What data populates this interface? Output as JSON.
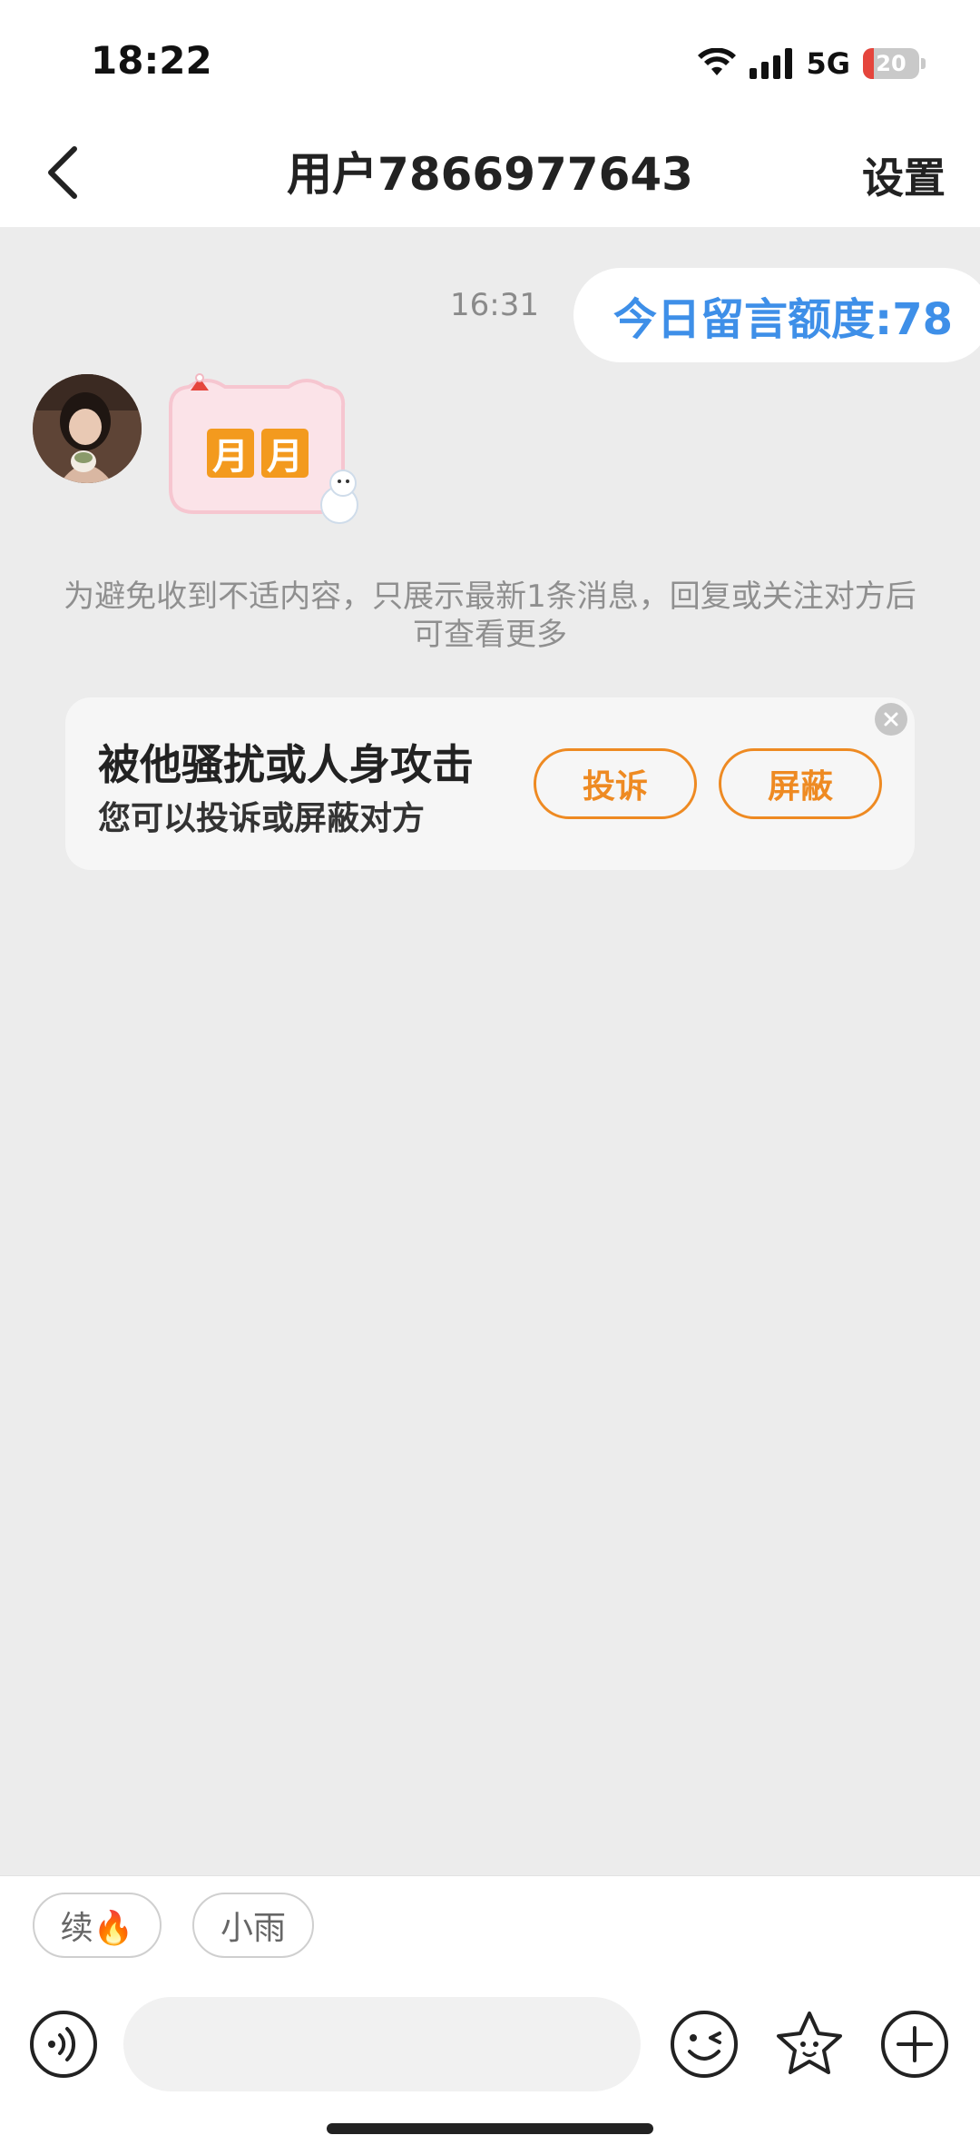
{
  "status_bar": {
    "time": "18:22",
    "network": "5G",
    "battery_level": 20,
    "battery_text": "20",
    "battery_color": "#e5453c",
    "icons": [
      "wifi-icon",
      "signal-icon",
      "battery-icon"
    ]
  },
  "header": {
    "back_icon": "chevron-left-icon",
    "title": "用户7866977643",
    "settings_label": "设置"
  },
  "chat": {
    "timestamp": "16:31",
    "quota_text": "今日留言额度:78",
    "quota_color": "#3e8fe8",
    "sticker_text": [
      "月",
      "月"
    ],
    "notice": "为避免收到不适内容，只展示最新1条消息，回复或关注对方后可查看更多"
  },
  "report_card": {
    "title": "被他骚扰或人身攻击",
    "subtitle": "您可以投诉或屏蔽对方",
    "complain_label": "投诉",
    "block_label": "屏蔽",
    "accent_color": "#ee8a22",
    "close_icon": "close-circle-icon"
  },
  "quick_replies": [
    "续🔥",
    "小雨"
  ],
  "input_bar": {
    "placeholder": "",
    "voice_icon": "voice-icon",
    "emoji_icon": "emoji-icon",
    "sticker_icon": "star-icon",
    "plus_icon": "plus-icon"
  }
}
